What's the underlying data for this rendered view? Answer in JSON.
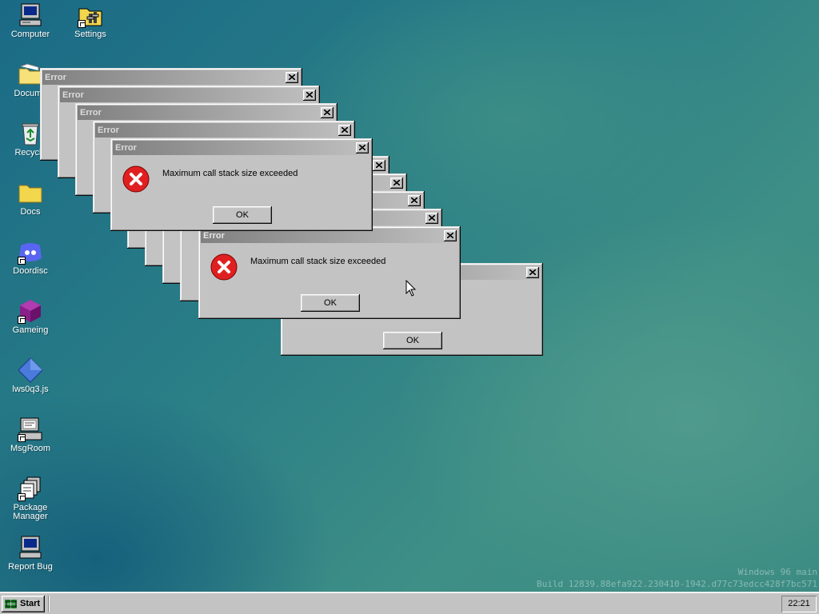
{
  "desktop": {
    "icons": [
      {
        "id": "computer",
        "label": "Computer",
        "icon": "computer-icon"
      },
      {
        "id": "settings",
        "label": "Settings",
        "icon": "settings-icon"
      },
      {
        "id": "documents",
        "label": "Docume",
        "icon": "folder-icon"
      },
      {
        "id": "recycle",
        "label": "Recycle",
        "icon": "recycle-bin-icon"
      },
      {
        "id": "docs",
        "label": "Docs",
        "icon": "folder-icon"
      },
      {
        "id": "doordisc",
        "label": "Doordisc",
        "icon": "doordisc-icon"
      },
      {
        "id": "gameing",
        "label": "Gameing",
        "icon": "gameing-icon"
      },
      {
        "id": "lws0q3",
        "label": "lws0q3.js",
        "icon": "js-diamond-icon"
      },
      {
        "id": "msgroom",
        "label": "MsgRoom",
        "icon": "msgroom-icon"
      },
      {
        "id": "package-manager",
        "label": "Package Manager",
        "icon": "package-manager-icon"
      },
      {
        "id": "report-bug",
        "label": "Report Bug",
        "icon": "report-bug-icon"
      }
    ]
  },
  "dialogs": {
    "title": "Error",
    "message": "Maximum call stack size exceeded",
    "ok_label": "OK"
  },
  "watermark": {
    "line1": "Windows 96 main",
    "line2": "Build 12839.88efa922.230410-1942.d77c73edcc428f7bc571"
  },
  "taskbar": {
    "start_label": "Start",
    "clock": "22:21"
  },
  "colors": {
    "error_red": "#e02020",
    "window_gray": "#c3c3c3",
    "inactive_title_start": "#808080",
    "inactive_title_end": "#c0c0c0"
  }
}
